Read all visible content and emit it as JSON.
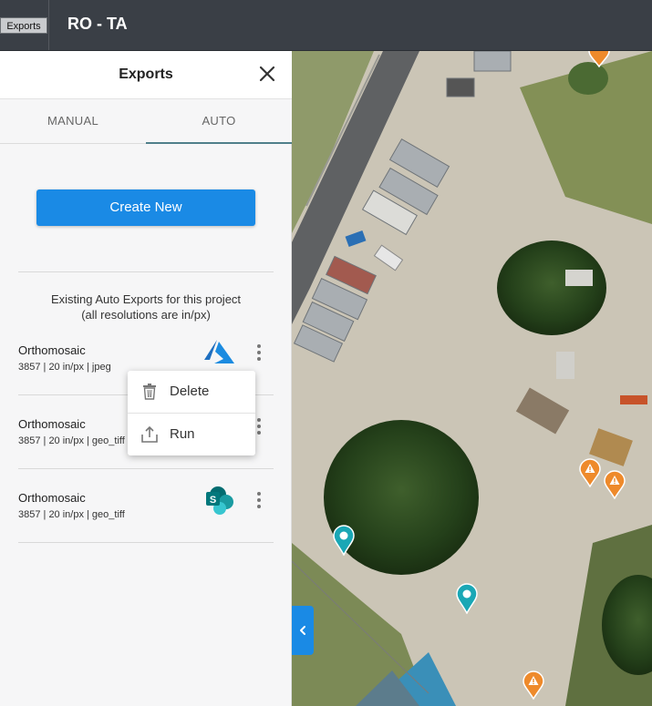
{
  "topbar": {
    "exports_tab_label": "Exports",
    "project_title": "RO - TA"
  },
  "panel": {
    "title": "Exports",
    "tabs": [
      {
        "label": "MANUAL",
        "active": false
      },
      {
        "label": "AUTO",
        "active": true
      }
    ],
    "create_button_label": "Create New",
    "info_line_1": "Existing Auto Exports for this project",
    "info_line_2": "(all resolutions are in/px)",
    "exports": [
      {
        "name": "Orthomosaic",
        "details": "3857 | 20 in/px | jpeg",
        "service_icon": "azure-icon"
      },
      {
        "name": "Orthomosaic",
        "details": "3857 | 20 in/px | geo_tiff",
        "service_icon": "azure-icon"
      },
      {
        "name": "Orthomosaic",
        "details": "3857 | 20 in/px | geo_tiff",
        "service_icon": "sharepoint-icon"
      }
    ],
    "context_menu": {
      "items": [
        {
          "label": "Delete",
          "icon": "trash-icon"
        },
        {
          "label": "Run",
          "icon": "upload-icon"
        }
      ]
    }
  },
  "colors": {
    "primary": "#1a8ae5",
    "topbar": "#3a3f46",
    "marker_teal": "#1aa7b5",
    "marker_orange": "#ee8a2b"
  }
}
